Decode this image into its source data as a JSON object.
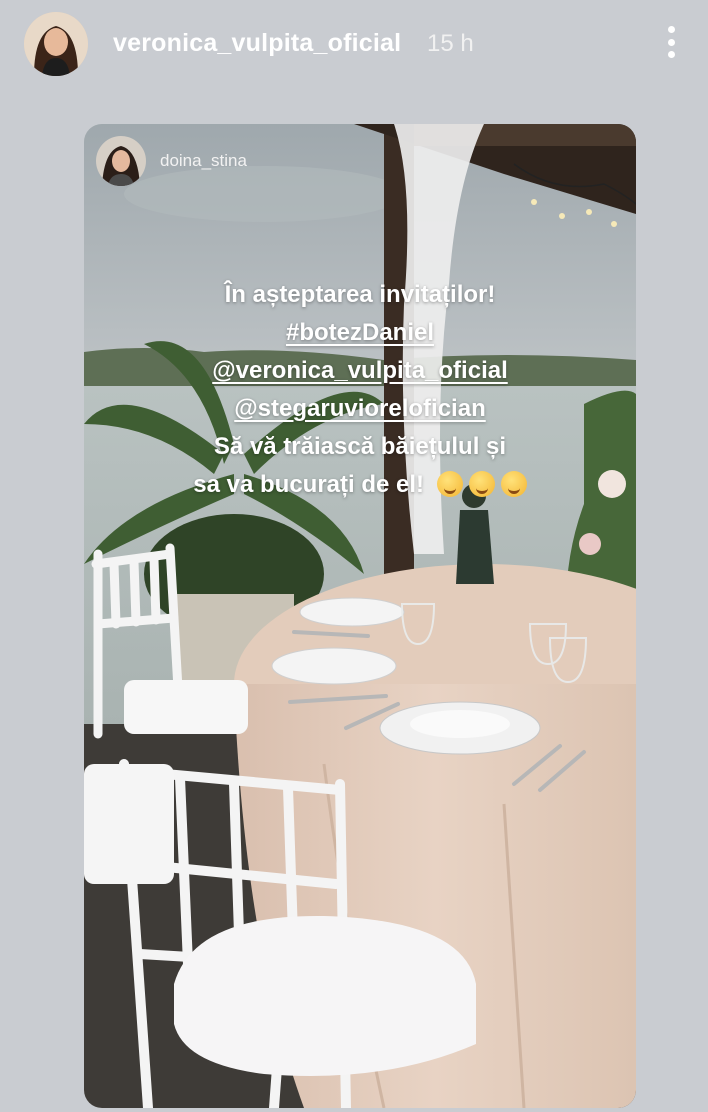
{
  "header": {
    "username": "veronica_vulpita_oficial",
    "time": "15 h",
    "more_icon": "more-vertical-icon"
  },
  "story": {
    "repost_username": "doina_stina",
    "caption": {
      "line1": "În așteptarea invitaților!",
      "hashtag": "#botezDaniel",
      "mention1": "@veronica_vulpita_oficial",
      "mention2": "@stegaruviorelofician",
      "line5": "Să vă trăiască băiețulul și",
      "line6": "sa va bucurați de el!",
      "emojis": "hugging-face-icon x3"
    }
  },
  "colors": {
    "background": "#c9ccd1",
    "text": "#ffffff",
    "tablecloth": "#e6cfbd"
  }
}
